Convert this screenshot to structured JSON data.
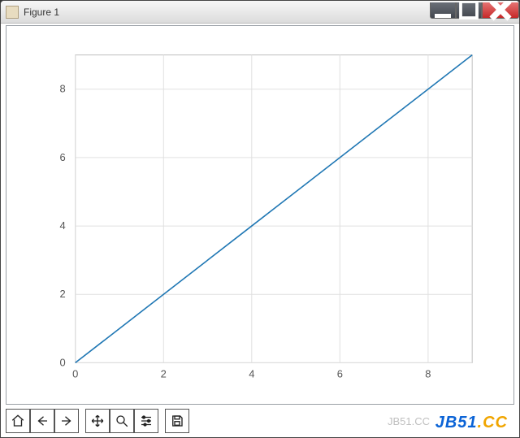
{
  "window": {
    "title": "Figure 1"
  },
  "chart_data": {
    "type": "line",
    "x": [
      0,
      1,
      2,
      3,
      4,
      5,
      6,
      7,
      8,
      9
    ],
    "y": [
      0,
      1,
      2,
      3,
      4,
      5,
      6,
      7,
      8,
      9
    ],
    "title": "",
    "xlabel": "",
    "ylabel": "",
    "xlim": [
      0,
      9
    ],
    "ylim": [
      0,
      9
    ],
    "xticks": [
      0,
      2,
      4,
      6,
      8
    ],
    "yticks": [
      0,
      2,
      4,
      6,
      8
    ],
    "grid": true
  },
  "toolbar": {
    "home": "Home",
    "back": "Back",
    "forward": "Forward",
    "pan": "Pan",
    "zoom": "Zoom",
    "configure": "Configure subplots",
    "save": "Save"
  },
  "watermark": {
    "brand_left": "JB51",
    "brand_right": ".CC",
    "sub": "JB51.CC"
  }
}
